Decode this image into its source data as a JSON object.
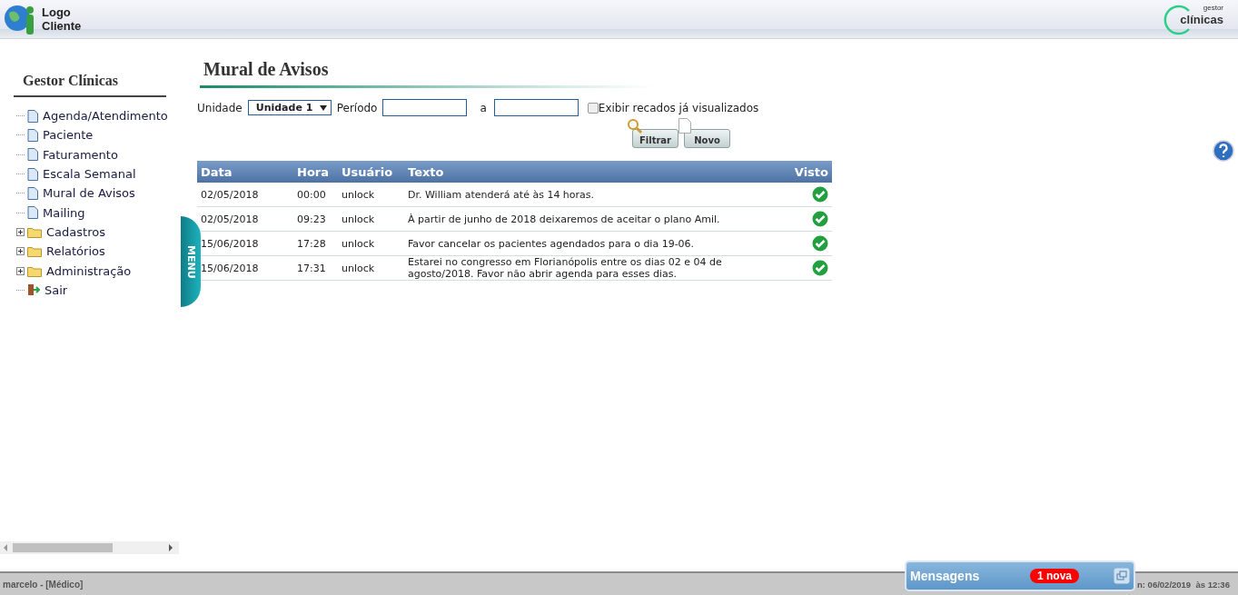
{
  "header": {
    "client_logo": "Logo Cliente",
    "brand_small": "gestor",
    "brand": "clínicas"
  },
  "sidebar": {
    "title": "Gestor Clínicas",
    "menu_tab": "MENU",
    "items": [
      {
        "label": "Agenda/Atendimento",
        "kind": "page"
      },
      {
        "label": "Paciente",
        "kind": "page"
      },
      {
        "label": "Faturamento",
        "kind": "page"
      },
      {
        "label": "Escala Semanal",
        "kind": "page"
      },
      {
        "label": "Mural de Avisos",
        "kind": "page"
      },
      {
        "label": "Mailing",
        "kind": "page"
      },
      {
        "label": "Cadastros",
        "kind": "folder",
        "expanded": false
      },
      {
        "label": "Relatórios",
        "kind": "folder",
        "expanded": false
      },
      {
        "label": "Administração",
        "kind": "folder",
        "expanded": false
      },
      {
        "label": "Sair",
        "kind": "exit"
      }
    ]
  },
  "page": {
    "title": "Mural de Avisos",
    "filters": {
      "unidade_label": "Unidade",
      "unidade_value": "Unidade 1",
      "periodo_label": "Período",
      "to_label": "a",
      "show_seen": {
        "label": "Exibir recados já visualizados",
        "checked": false
      }
    },
    "buttons": [
      {
        "label": "Filtrar",
        "kind": "search"
      },
      {
        "label": "Novo",
        "kind": "new"
      }
    ],
    "table": {
      "columns": [
        "Data",
        "Hora",
        "Usuário",
        "Texto",
        "Visto"
      ],
      "rows": [
        {
          "data": "02/05/2018",
          "hora": "00:00",
          "usuario": "unlock",
          "texto": "Dr. William atenderá até às 14 horas.",
          "visto": true
        },
        {
          "data": "02/05/2018",
          "hora": "09:23",
          "usuario": "unlock",
          "texto": "À partir de junho de 2018 deixaremos de aceitar o plano Amil.",
          "visto": true
        },
        {
          "data": "15/06/2018",
          "hora": "17:28",
          "usuario": "unlock",
          "texto": "Favor cancelar os pacientes agendados para o dia 19-06.",
          "visto": true
        },
        {
          "data": "15/06/2018",
          "hora": "17:31",
          "usuario": "unlock",
          "texto": "Estarei no congresso em Florianópolis entre os dias 02 e 04 de agosto/2018. Favor não abrir agenda para esses dias.",
          "visto": true
        }
      ]
    }
  },
  "status_bar": {
    "user": "marcelo - [Médico]",
    "login": "n: 06/02/2019  às 12:36"
  },
  "messages": {
    "title": "Mensagens",
    "badge": "1 nova"
  }
}
